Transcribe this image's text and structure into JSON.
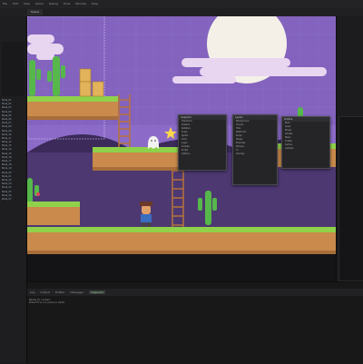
{
  "menubar": {
    "items": [
      "File",
      "Edit",
      "View",
      "Game",
      "Debug",
      "Tools",
      "Window",
      "Help"
    ]
  },
  "scene_tab": {
    "label": "Scene"
  },
  "left_panel": {
    "rows": [
      "Node_01",
      "Node_02",
      "Node_03",
      "Node_04",
      "Node_05",
      "Node_06",
      "Node_07",
      "Node_08",
      "Node_09",
      "Node_10",
      "Node_11",
      "Node_12",
      "Node_13",
      "Node_14",
      "Node_15",
      "Node_16",
      "Node_17",
      "Node_18",
      "Node_19",
      "Node_20",
      "Node_21",
      "Node_22",
      "Node_23",
      "Node_24",
      "Node_25",
      "Node_26",
      "Node_27"
    ]
  },
  "bottom_bar": {
    "tabs": [
      "Log",
      "Output",
      "Profiler",
      "Debugger",
      "Inspector"
    ],
    "active_index": 4
  },
  "console": {
    "lines": [
      "Ready for content",
      "Press F5 to run scene in editor"
    ]
  },
  "inspector_window": {
    "title": "Inspector",
    "rows": [
      "Transform",
      "Position",
      "Rotation",
      "Scale",
      "Sprite",
      "Color",
      "Layer",
      "Collider",
      "Script",
      "Options"
    ]
  },
  "layers_window": {
    "title": "Layers",
    "rows": [
      "Background",
      "Clouds",
      "Hills",
      "Platforms",
      "Props",
      "Player",
      "Enemies",
      "Pickups",
      "UI",
      "Overlay"
    ]
  },
  "outline_window": {
    "title": "Outline",
    "rows": [
      "Root",
      "Level",
      "Player",
      "Ghosts",
      "Stars",
      "Crates",
      "Cactus",
      "Ladders"
    ]
  },
  "colors": {
    "sky": "#8c6bc8",
    "moon": "#f4f0e8",
    "grass": "#8fd14a",
    "dirt": "#c98a4b",
    "editor_bg": "#1b1b1d",
    "accent_green": "#8ee08e"
  }
}
